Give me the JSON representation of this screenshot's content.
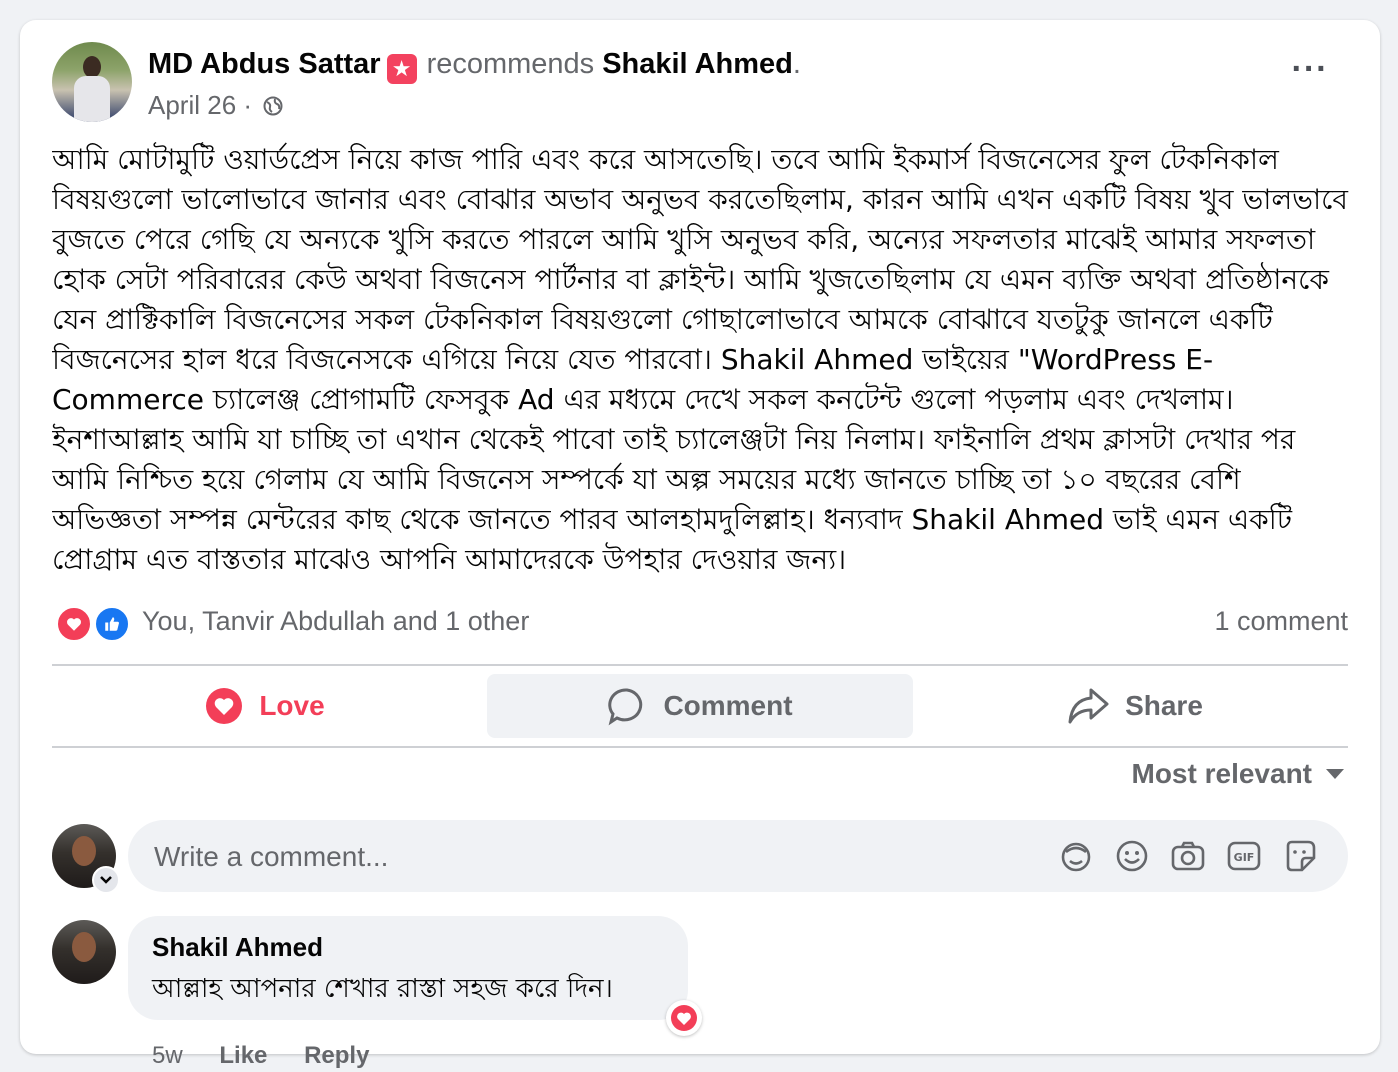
{
  "post": {
    "author": "MD Abdus Sattar",
    "badge_icon": "star-badge-icon",
    "recommends_text": "recommends",
    "recommended": "Shakil Ahmed",
    "recommended_punct": ".",
    "date": "April 26",
    "separator": "·",
    "privacy_icon": "globe-icon",
    "more_label": "···",
    "body": "আমি  মোটামুটি ওয়ার্ডপ্রেস নিয়ে কাজ পারি এবং করে আসতেছি। তবে আমি ইকমার্স বিজনেসের ফুল টেকনিকাল বিষয়গুলো ভালোভাবে জানার এবং বোঝার অভাব অনুভব করতেছিলাম, কারন আমি এখন একটি বিষয় খুব ভালভাবে বুজতে পেরে গেছি যে অন্যকে খুসি করতে পারলে আমি খুসি অনুভব করি, অন্যের সফলতার মাঝেই আমার সফলতা হোক সেটা পরিবারের কেউ অথবা বিজনেস পার্টনার বা ক্লাইন্ট। আমি খুজতেছিলাম যে এমন ব্যক্তি অথবা প্রতিষ্ঠানকে  যেন প্রাক্টিকালি বিজনেসের সকল টেকনিকাল বিষয়গুলো গোছালোভাবে আমকে বোঝাবে যতটুকু জানলে একটি বিজনেসের হাল ধরে বিজনেসকে এগিয়ে নিয়ে যেত পারবো। Shakil Ahmed ভাইয়ের \"WordPress E-Commerce চ্যালেঞ্জ প্রোগামটি ফেসবুক Ad এর মধ্যমে দেখে সকল কনটেন্ট গুলো পড়লাম এবং দেখলাম। ইনশাআল্লাহ আমি যা চাচ্ছি তা এখান থেকেই পাবো তাই চ্যালেঞ্জটা নিয় নিলাম। ফাইনালি প্রথম ক্লাসটা দেখার পর আমি নিশ্চিত হয়ে গেলাম যে আমি বিজনেস সম্পর্কে যা অল্প সময়ের মধ্যে জানতে চাচ্ছি তা  ১০ বছরের বেশি অভিজ্ঞতা সম্পন্ন মেন্টরের কাছ থেকে জানতে পারব আলহামদুলিল্লাহ। ধন্যবাদ Shakil Ahmed ভাই এমন একটি প্রোগ্রাম এত বাস্ততার মাঝেও আপনি আমাদেরকে উপহার দেওয়ার জন্য।"
  },
  "reactions": {
    "icons": [
      "love-reaction-icon",
      "like-reaction-icon"
    ],
    "summary": "You, Tanvir Abdullah and 1 other",
    "comment_count": "1 comment"
  },
  "actions": {
    "love": "Love",
    "comment": "Comment",
    "share": "Share"
  },
  "sort": {
    "label": "Most relevant"
  },
  "composer": {
    "placeholder": "Write a comment...",
    "tools": [
      "avatar-sticker-icon",
      "emoji-icon",
      "camera-icon",
      "gif-icon",
      "sticker-icon"
    ]
  },
  "comments": [
    {
      "author": "Shakil Ahmed",
      "text": "আল্লাহ আপনার শেখার রাস্তা সহজ করে দিন।",
      "reaction_icon": "love-reaction-icon",
      "time": "5w",
      "like_label": "Like",
      "reply_label": "Reply"
    }
  ],
  "colors": {
    "love": "#f33e58",
    "like": "#1877f2",
    "secondary_text": "#65676b",
    "primary_text": "#050505",
    "surface": "#f0f2f5"
  }
}
